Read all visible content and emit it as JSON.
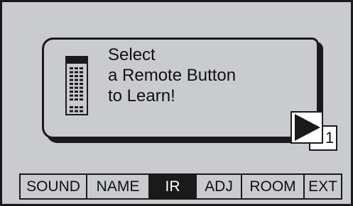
{
  "dialog": {
    "message_lines": [
      "Select",
      "a Remote Button",
      "to Learn!"
    ],
    "icon": "remote-control-icon",
    "next_icon": "play-arrow-icon",
    "page_number": "1"
  },
  "tabs": [
    {
      "label": "SOUND",
      "active": false
    },
    {
      "label": "NAME",
      "active": false
    },
    {
      "label": "IR",
      "active": true
    },
    {
      "label": "ADJ",
      "active": false
    },
    {
      "label": "ROOM",
      "active": false
    },
    {
      "label": "EXT",
      "active": false
    }
  ],
  "colors": {
    "background": "#cacbce",
    "foreground": "#1a1a1a",
    "active_tab_text": "#ffffff"
  }
}
